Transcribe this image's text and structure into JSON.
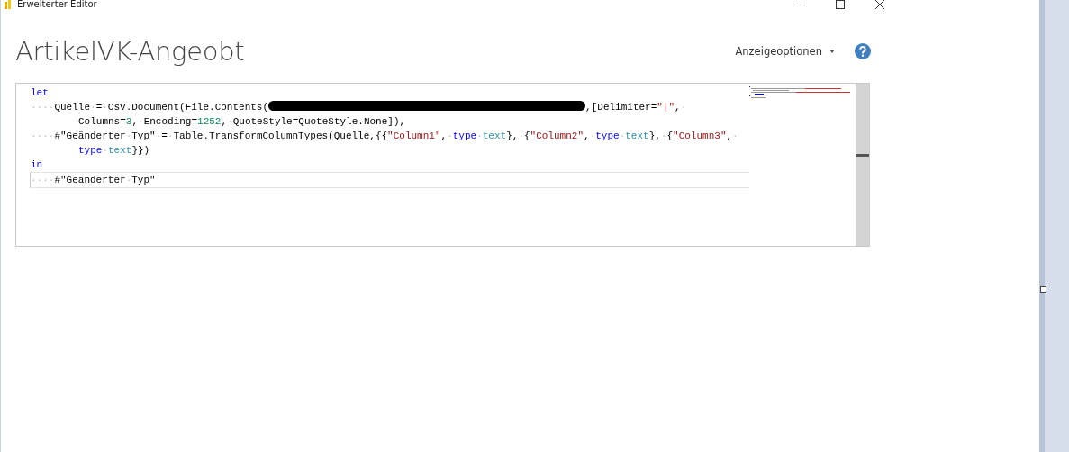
{
  "window": {
    "title": "Erweiterter Editor"
  },
  "heading": "ArtikelVK-Angeobt",
  "toolbar": {
    "display_options": "Anzeigeoptionen"
  },
  "editor": {
    "lines": [
      {
        "wrapped": false,
        "current": false,
        "tokens": [
          {
            "kind": "keyword",
            "text": "let"
          }
        ]
      },
      {
        "wrapped": false,
        "current": false,
        "tokens": [
          {
            "kind": "ws",
            "text": "····"
          },
          {
            "kind": "plain",
            "text": "Quelle"
          },
          {
            "kind": "ws",
            "text": "·"
          },
          {
            "kind": "plain",
            "text": "="
          },
          {
            "kind": "ws",
            "text": "·"
          },
          {
            "kind": "plain",
            "text": "Csv.Document(File.Contents("
          },
          {
            "kind": "redacted"
          },
          {
            "kind": "plain",
            "text": ",[Delimiter="
          },
          {
            "kind": "string",
            "text": "\"|\""
          },
          {
            "kind": "plain",
            "text": ","
          },
          {
            "kind": "ws",
            "text": "·"
          }
        ]
      },
      {
        "wrapped": true,
        "current": false,
        "tokens": [
          {
            "kind": "plain",
            "text": "Columns="
          },
          {
            "kind": "number",
            "text": "3"
          },
          {
            "kind": "plain",
            "text": ","
          },
          {
            "kind": "ws",
            "text": "·"
          },
          {
            "kind": "plain",
            "text": "Encoding="
          },
          {
            "kind": "number",
            "text": "1252"
          },
          {
            "kind": "plain",
            "text": ","
          },
          {
            "kind": "ws",
            "text": "·"
          },
          {
            "kind": "plain",
            "text": "QuoteStyle=QuoteStyle.None]),"
          }
        ]
      },
      {
        "wrapped": false,
        "current": false,
        "tokens": [
          {
            "kind": "ws",
            "text": "····"
          },
          {
            "kind": "plain",
            "text": "#\"Geänderter"
          },
          {
            "kind": "ws",
            "text": "·"
          },
          {
            "kind": "plain",
            "text": "Typ\""
          },
          {
            "kind": "ws",
            "text": "·"
          },
          {
            "kind": "plain",
            "text": "="
          },
          {
            "kind": "ws",
            "text": "·"
          },
          {
            "kind": "plain",
            "text": "Table.TransformColumnTypes(Quelle,{{"
          },
          {
            "kind": "string",
            "text": "\"Column1\""
          },
          {
            "kind": "plain",
            "text": ","
          },
          {
            "kind": "ws",
            "text": "·"
          },
          {
            "kind": "keyword",
            "text": "type"
          },
          {
            "kind": "ws",
            "text": "·"
          },
          {
            "kind": "type",
            "text": "text"
          },
          {
            "kind": "plain",
            "text": "},"
          },
          {
            "kind": "ws",
            "text": "·"
          },
          {
            "kind": "plain",
            "text": "{"
          },
          {
            "kind": "string",
            "text": "\"Column2\""
          },
          {
            "kind": "plain",
            "text": ","
          },
          {
            "kind": "ws",
            "text": "·"
          },
          {
            "kind": "keyword",
            "text": "type"
          },
          {
            "kind": "ws",
            "text": "·"
          },
          {
            "kind": "type",
            "text": "text"
          },
          {
            "kind": "plain",
            "text": "},"
          },
          {
            "kind": "ws",
            "text": "·"
          },
          {
            "kind": "plain",
            "text": "{"
          },
          {
            "kind": "string",
            "text": "\"Column3\""
          },
          {
            "kind": "plain",
            "text": ","
          },
          {
            "kind": "ws",
            "text": "·"
          }
        ]
      },
      {
        "wrapped": true,
        "current": false,
        "tokens": [
          {
            "kind": "keyword",
            "text": "type"
          },
          {
            "kind": "ws",
            "text": "·"
          },
          {
            "kind": "type",
            "text": "text"
          },
          {
            "kind": "plain",
            "text": "}})"
          }
        ]
      },
      {
        "wrapped": false,
        "current": false,
        "tokens": [
          {
            "kind": "keyword",
            "text": "in"
          }
        ]
      },
      {
        "wrapped": false,
        "current": true,
        "tokens": [
          {
            "kind": "ws",
            "text": "····"
          },
          {
            "kind": "plain",
            "text": "#\"Geänderter"
          },
          {
            "kind": "ws",
            "text": "·"
          },
          {
            "kind": "plain",
            "text": "Typ\""
          }
        ]
      }
    ]
  }
}
